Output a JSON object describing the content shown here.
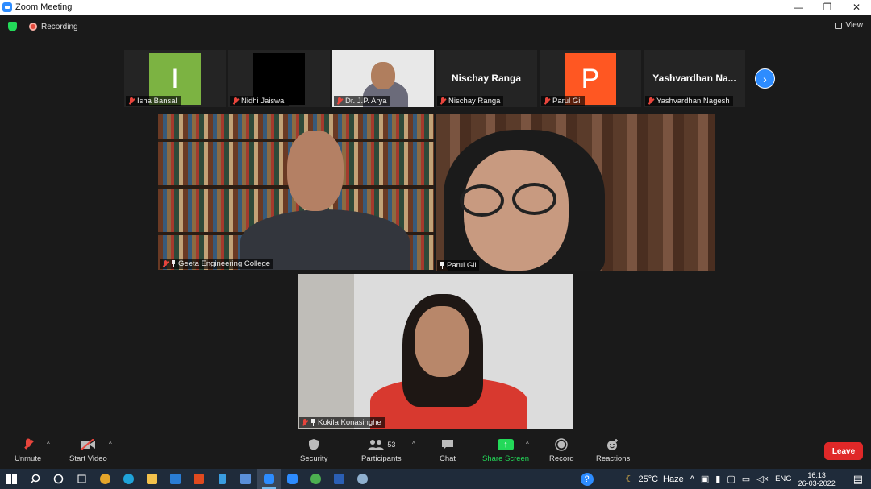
{
  "window": {
    "title": "Zoom Meeting"
  },
  "topbar": {
    "recording_label": "Recording",
    "view_label": "View"
  },
  "filmstrip": [
    {
      "name": "Isha Bansal",
      "initial": "I",
      "avatar_color": "#7cb342",
      "type": "initial"
    },
    {
      "name": "Nidhi Jaiswal",
      "avatar_color": "#000000",
      "type": "black"
    },
    {
      "name": "Dr. J.P. Arya",
      "type": "video"
    },
    {
      "name": "Nischay Ranga",
      "display": "Nischay Ranga",
      "type": "name"
    },
    {
      "name": "Parul Gil",
      "initial": "P",
      "avatar_color": "#ff5722",
      "type": "initial"
    },
    {
      "name": "Yashvardhan Nagesh",
      "display": "Yashvardhan  Na...",
      "type": "name"
    }
  ],
  "main_videos": {
    "left": {
      "name": "Geeta Engineering College",
      "muted": true,
      "pinned": true
    },
    "right": {
      "name": "Parul Gil",
      "muted": false,
      "pinned": true,
      "active_speaker": true
    },
    "bottom": {
      "name": "Kokila Konasinghe",
      "muted": true,
      "pinned": true
    }
  },
  "toolbar": {
    "unmute": "Unmute",
    "start_video": "Start Video",
    "security": "Security",
    "participants": "Participants",
    "participants_count": "53",
    "chat": "Chat",
    "share_screen": "Share Screen",
    "record": "Record",
    "reactions": "Reactions",
    "leave": "Leave"
  },
  "taskbar": {
    "weather_temp": "25°C",
    "weather_desc": "Haze",
    "language": "ENG",
    "time": "16:13",
    "date": "26-03-2022"
  },
  "colors": {
    "accent": "#2d8cff",
    "share_green": "#23d959",
    "leave_red": "#e02828",
    "active_speaker_border": "#e6f25a"
  }
}
